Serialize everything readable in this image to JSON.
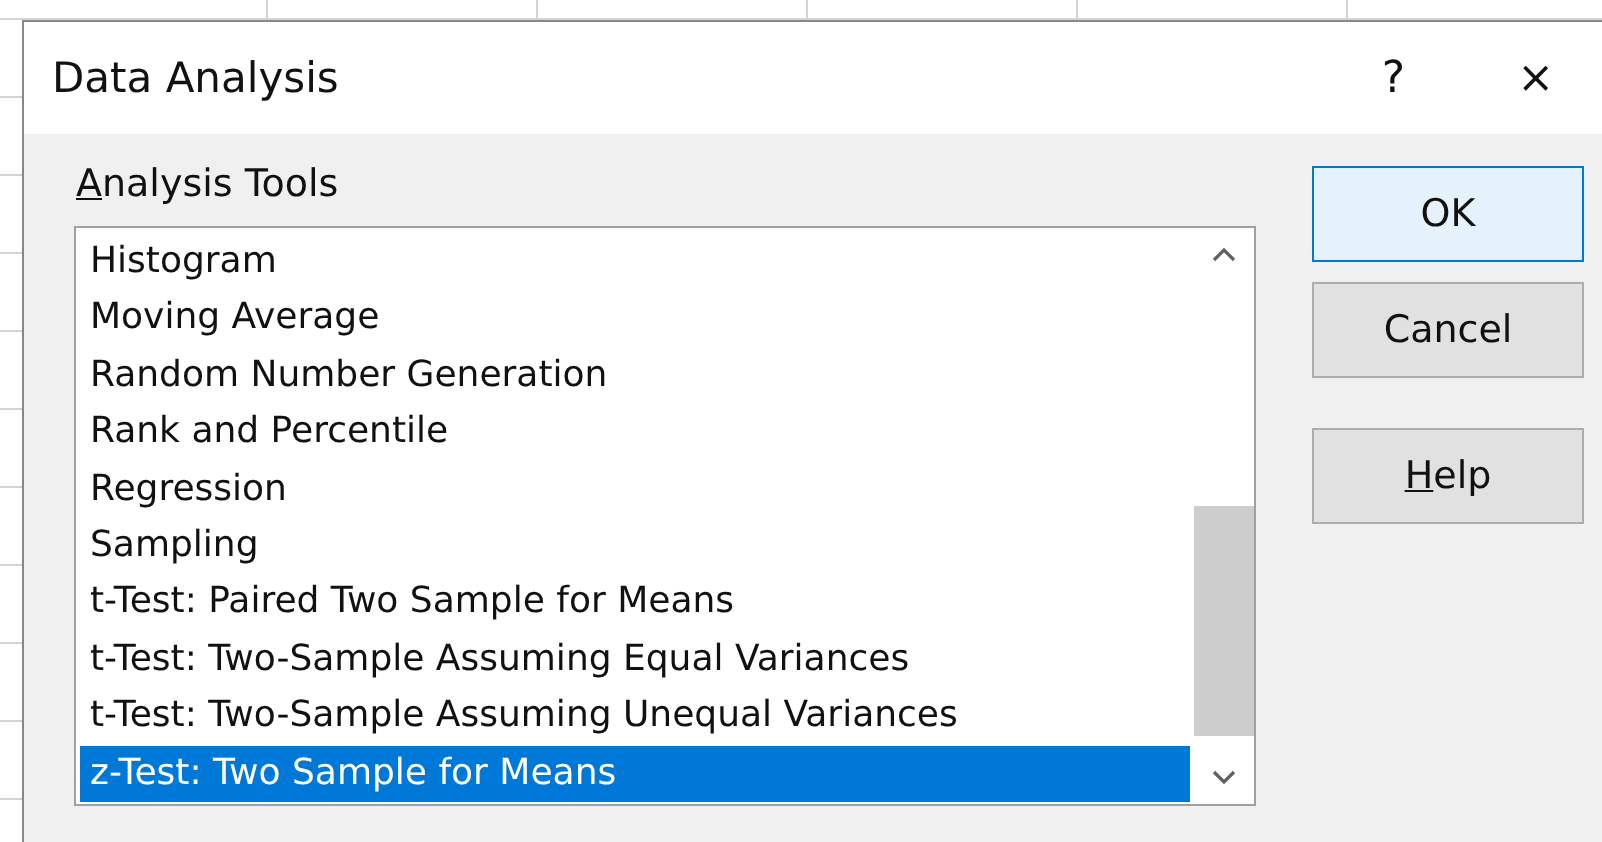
{
  "window": {
    "title": "Data Analysis",
    "help_glyph": "?",
    "close_glyph": "×"
  },
  "tools": {
    "label": "Analysis Tools",
    "mnemonic": true,
    "items": [
      {
        "label": "Histogram",
        "selected": false
      },
      {
        "label": "Moving Average",
        "selected": false
      },
      {
        "label": "Random Number Generation",
        "selected": false
      },
      {
        "label": "Rank and Percentile",
        "selected": false
      },
      {
        "label": "Regression",
        "selected": false
      },
      {
        "label": "Sampling",
        "selected": false
      },
      {
        "label": "t-Test: Paired Two Sample for Means",
        "selected": false
      },
      {
        "label": "t-Test: Two-Sample Assuming Equal Variances",
        "selected": false
      },
      {
        "label": "t-Test: Two-Sample Assuming Unequal Variances",
        "selected": false
      },
      {
        "label": "z-Test: Two Sample for Means",
        "selected": true
      }
    ]
  },
  "buttons": [
    {
      "label": "OK",
      "default": true,
      "mnemonic": false
    },
    {
      "label": "Cancel",
      "default": false,
      "mnemonic": false
    },
    {
      "label": "Help",
      "default": false,
      "mnemonic": true
    }
  ]
}
